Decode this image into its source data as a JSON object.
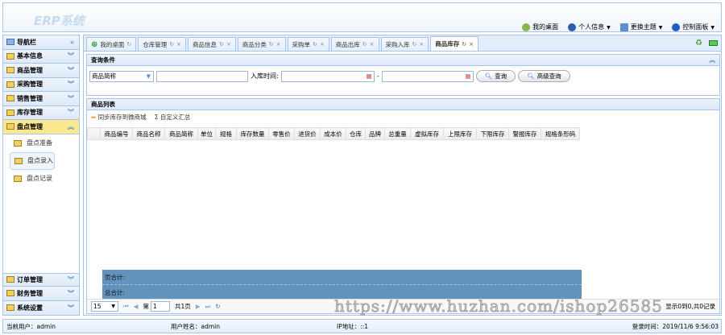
{
  "header": {
    "logo": "ERP系统",
    "menu": [
      {
        "label": "我的桌面",
        "icon": "desktop-icon"
      },
      {
        "label": "个人信息",
        "icon": "user-icon"
      },
      {
        "label": "更换主题",
        "icon": "theme-icon"
      },
      {
        "label": "控制面板",
        "icon": "help-icon"
      }
    ]
  },
  "sidebar": {
    "title": "导航栏",
    "groups_top": [
      "基本信息",
      "商品管理",
      "采购管理",
      "销售管理",
      "库存管理"
    ],
    "active_group": "盘点管理",
    "sub_items": [
      "盘点准备",
      "盘点录入",
      "盘点记录"
    ],
    "groups_bottom": [
      "订单管理",
      "财务管理",
      "系统设置"
    ]
  },
  "tabs": [
    "我的桌面",
    "仓库管理",
    "商品信息",
    "商品分类",
    "采购单",
    "商品出库",
    "采购入库",
    "商品库存"
  ],
  "query": {
    "title": "查询条件",
    "select_value": "商品简称",
    "text_value": "",
    "date_label": "入库时间:",
    "date_sep": "-",
    "search_label": "查询",
    "advanced_label": "高级查询"
  },
  "list": {
    "title": "商品列表",
    "sync_label": "同步库存到微商城",
    "sum_label": "自定义汇总",
    "columns": [
      "商品编号",
      "商品名称",
      "商品简称",
      "单位",
      "规格",
      "库存数量",
      "零售价",
      "进货价",
      "成本价",
      "仓库",
      "品牌",
      "总重量",
      "虚拟库存",
      "上限库存",
      "下限库存",
      "警报库存",
      "规格条形码"
    ],
    "page_total": "页合计:",
    "grand_total": "总合计:"
  },
  "pager": {
    "page_size": "15",
    "page_prefix": "第",
    "page": "1",
    "page_suffix": "共1页",
    "info": "显示0到0,共0记录"
  },
  "watermark": "https://www.huzhan.com/ishop26585",
  "status": {
    "user": "当前用户：admin",
    "name": "用户姓名：admin",
    "ip": "IP地址：::1",
    "login": "登录时间：2019/11/6 9:56:03"
  }
}
